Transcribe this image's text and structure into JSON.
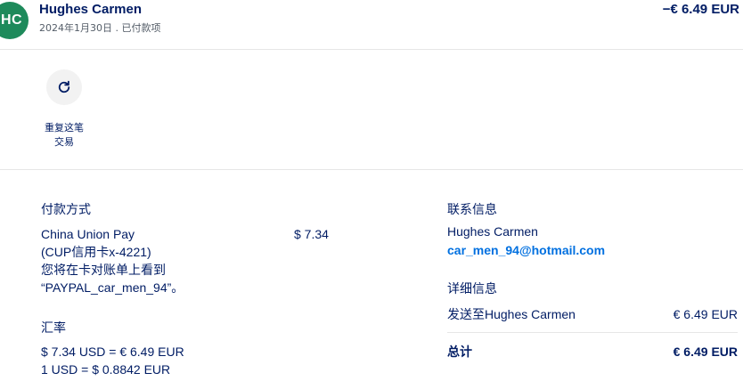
{
  "header": {
    "avatar_initials": "HC",
    "name": "Hughes Carmen",
    "subtitle": "2024年1月30日 . 已付款项",
    "amount": "−€ 6.49 EUR"
  },
  "actions": {
    "repeat_icon": "refresh-icon",
    "repeat_label_line1": "重复这笔",
    "repeat_label_line2": "交易"
  },
  "payment": {
    "label": "付款方式",
    "method_line1": "China Union Pay",
    "method_line2": "(CUP信用卡x-4221)",
    "method_line3": "您将在卡对账单上看到",
    "method_line4": "“PAYPAL_car_men_94”。",
    "amount": "$ 7.34"
  },
  "exchange": {
    "label": "汇率",
    "line1": "$ 7.34 USD = € 6.49 EUR",
    "line2": "1 USD = $ 0.8842 EUR"
  },
  "contact": {
    "label": "联系信息",
    "name": "Hughes Carmen",
    "email": "car_men_94@hotmail.com"
  },
  "details": {
    "label": "详细信息",
    "sent_to_label": "发送至Hughes Carmen",
    "sent_to_amount": "€ 6.49 EUR",
    "total_label": "总计",
    "total_amount": "€ 6.49 EUR"
  },
  "colors": {
    "text": "#001c64",
    "link": "#0070e0",
    "avatar": "#1e8a5b"
  }
}
